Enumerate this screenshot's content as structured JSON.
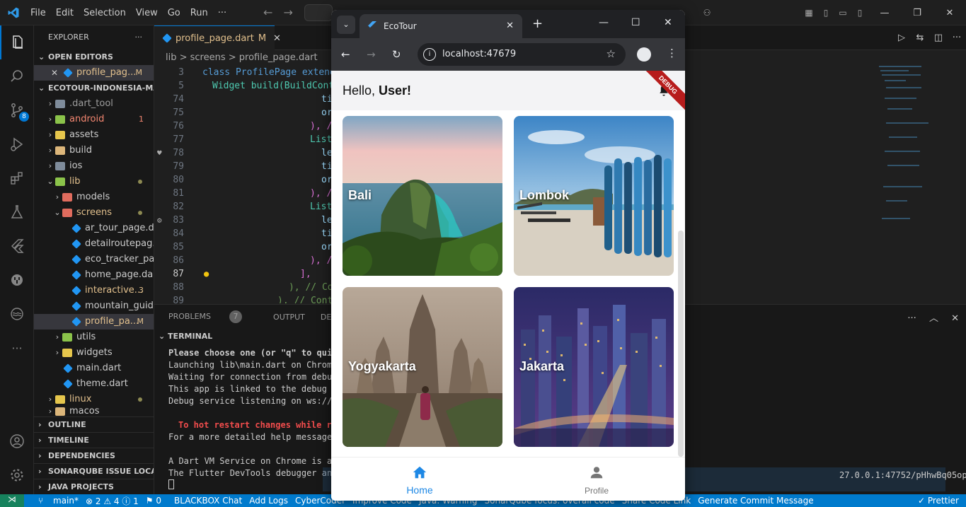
{
  "titlebar": {
    "menu": [
      "File",
      "Edit",
      "Selection",
      "View",
      "Go",
      "Run",
      "···"
    ]
  },
  "activity_bar": {
    "scm_badge": "8"
  },
  "explorer": {
    "title": "EXPLORER",
    "more": "···",
    "open_editors": {
      "label": "OPEN EDITORS",
      "items": [
        {
          "name": "profile_pag...",
          "status": "M"
        }
      ]
    },
    "project": {
      "label": "ECOTOUR-INDONESIA-MAIN",
      "items": [
        {
          "name": ".dart_tool"
        },
        {
          "name": "android",
          "decoration": "1"
        },
        {
          "name": "assets"
        },
        {
          "name": "build"
        },
        {
          "name": "ios"
        },
        {
          "name": "lib"
        },
        {
          "name": "models"
        },
        {
          "name": "screens"
        },
        {
          "name": "ar_tour_page.d..."
        },
        {
          "name": "detailroutepag..."
        },
        {
          "name": "eco_tracker_pa..."
        },
        {
          "name": "home_page.dart"
        },
        {
          "name": "interactive...",
          "decoration": "3"
        },
        {
          "name": "mountain_guid..."
        },
        {
          "name": "profile_pa...",
          "decoration": "M"
        },
        {
          "name": "utils"
        },
        {
          "name": "widgets"
        },
        {
          "name": "main.dart"
        },
        {
          "name": "theme.dart"
        },
        {
          "name": "linux"
        },
        {
          "name": "macos"
        }
      ]
    },
    "bottom_sections": [
      "OUTLINE",
      "TIMELINE",
      "DEPENDENCIES",
      "SONARQUBE ISSUE LOCAT...",
      "JAVA PROJECTS"
    ]
  },
  "editor": {
    "tab_label": "profile_page.dart",
    "tab_status": "M",
    "breadcrumb": "lib > screens > profile_page.dart",
    "lines": [
      {
        "n": "3",
        "text": "class ProfilePage extends"
      },
      {
        "n": "5",
        "text": "Widget build(BuildCont"
      },
      {
        "n": "74",
        "text": "ti"
      },
      {
        "n": "75",
        "text": "or"
      },
      {
        "n": "76",
        "text": "), //"
      },
      {
        "n": "77",
        "text": "List"
      },
      {
        "n": "78",
        "text": "le"
      },
      {
        "n": "79",
        "text": "ti"
      },
      {
        "n": "80",
        "text": "or"
      },
      {
        "n": "81",
        "text": "), //"
      },
      {
        "n": "82",
        "text": "List"
      },
      {
        "n": "83",
        "text": "le"
      },
      {
        "n": "84",
        "text": "ti"
      },
      {
        "n": "85",
        "text": "or"
      },
      {
        "n": "86",
        "text": "), //"
      },
      {
        "n": "87",
        "text": "],"
      },
      {
        "n": "88",
        "text": "), // Co"
      },
      {
        "n": "89",
        "text": "), // Cont"
      }
    ]
  },
  "panel": {
    "tabs": [
      {
        "label": "PROBLEMS",
        "badge": "7"
      },
      {
        "label": "OUTPUT"
      },
      {
        "label": "DEBUG CONS"
      }
    ],
    "terminal_label": "TERMINAL",
    "terminal_lines": [
      "Please choose one (or \"q\" to quit",
      "Launching lib\\main.dart on Chrome",
      "Waiting for connection from debug",
      "This app is linked to the debug s",
      "Debug service listening on ws://1",
      "",
      "To hot restart changes while ru",
      "For a more detailed help message,",
      "",
      "A Dart VM Service on Chrome is av",
      "The Flutter DevTools debugger and"
    ],
    "terminal_right": "27.0.0.1:47752/pHhwBq05opI="
  },
  "statusbar": {
    "items": [
      "main*",
      "⊗ 2 ⚠ 4 ⓘ 1",
      "⚑ 0",
      "BLACKBOX Chat",
      "Add Logs",
      "CyberCoder",
      "Improve Code",
      "Java: Warning",
      "SonarQube focus: overall code",
      "Share Code Link",
      "Generate Commit Message"
    ],
    "right": "✓ Prettier"
  },
  "browser": {
    "tab_title": "EcoTour",
    "url": "localhost:47679"
  },
  "app": {
    "greeting": "Hello, ",
    "user": "User!",
    "debug_banner": "DEBUG",
    "destinations": [
      "Bali",
      "Lombok",
      "Yogyakarta",
      "Jakarta"
    ],
    "nav": [
      {
        "label": "Home",
        "active": true
      },
      {
        "label": "Profile",
        "active": false
      }
    ],
    "colors": {
      "accent": "#1e88e5",
      "inactive": "#757575"
    }
  }
}
